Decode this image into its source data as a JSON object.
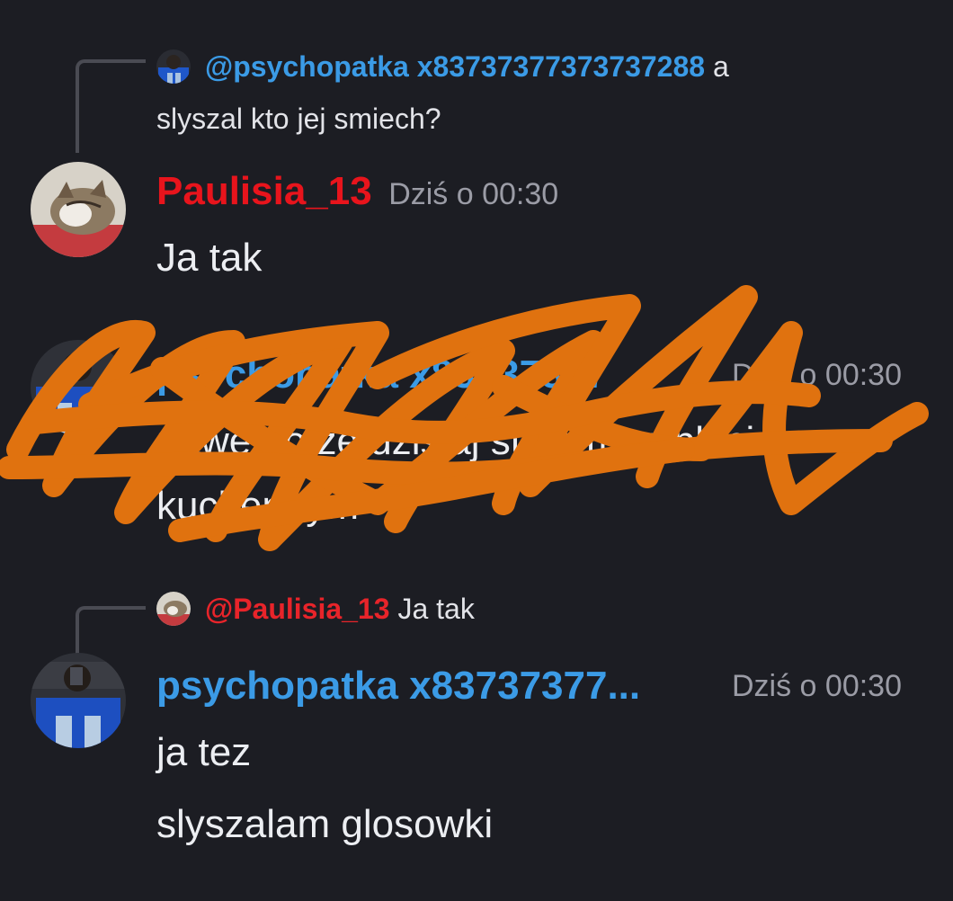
{
  "messages": [
    {
      "reply": {
        "mention": "@psychopatka x83737377373737288",
        "text_inline": "a",
        "text_line2": "slyszal kto jej smiech?"
      },
      "author": "Paulisia_13",
      "timestamp": "Dziś o 00:30",
      "lines": [
        "Ja tak"
      ]
    },
    {
      "author": "psychopatka x83737377",
      "timestamp": "Dziś o 00:30",
      "lines": [
        "nawet to ze dzisiaj stalam na blacie",
        "kuchennym"
      ],
      "scribbled": true
    },
    {
      "reply": {
        "mention": "@Paulisia_13",
        "text_inline": "Ja tak"
      },
      "author": "psychopatka x83737377...",
      "timestamp": "Dziś o 00:30",
      "lines": [
        "ja tez",
        "slyszalam glosowki"
      ]
    }
  ],
  "colors": {
    "background": "#1c1d23",
    "mention_blue": "#3b9be6",
    "name_red": "#e8141c",
    "scribble_orange": "#e0720f"
  },
  "icons": [
    "avatar-psychopatka",
    "avatar-paulisia-cat"
  ]
}
